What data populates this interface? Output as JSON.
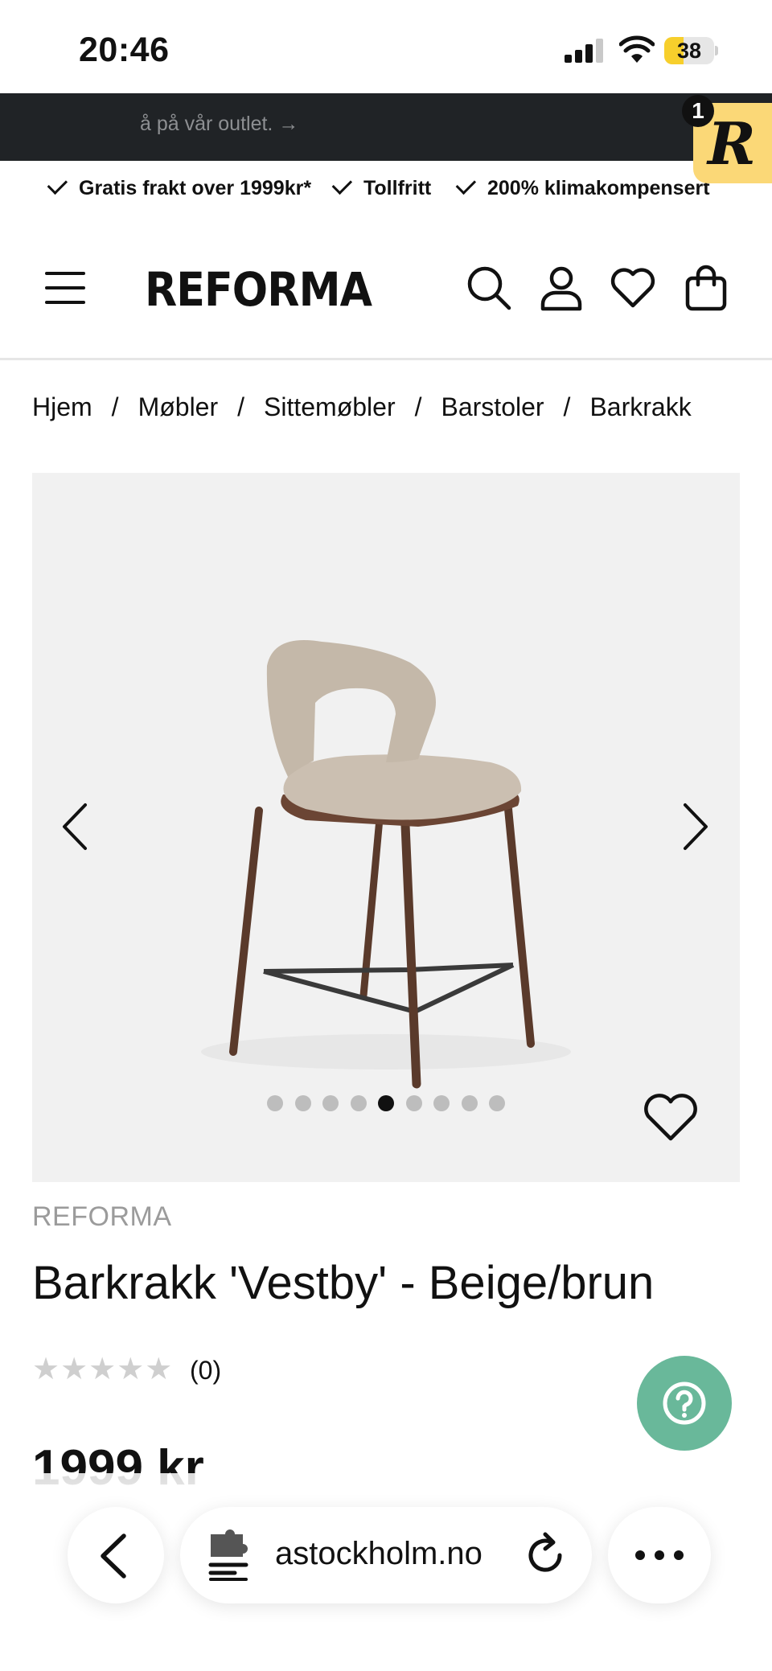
{
  "status_bar": {
    "time": "20:46",
    "battery_level": "38",
    "battery_fraction": 0.38,
    "battery_color": "#f7cf2c"
  },
  "announcement": {
    "text": "å på vår outlet. →",
    "background": "#202326"
  },
  "reviews_widget": {
    "letter": "R",
    "count": "1",
    "color": "#fbd877"
  },
  "usp": {
    "items": [
      {
        "label": "Gratis frakt over 1999kr*"
      },
      {
        "label": "Tollfritt"
      },
      {
        "label": "200% klimakompensert"
      }
    ]
  },
  "header": {
    "logo": "REFORMA",
    "icons": [
      "menu-icon",
      "search-icon",
      "account-icon",
      "wishlist-icon",
      "cart-icon"
    ]
  },
  "breadcrumb": {
    "items": [
      "Hjem",
      "Møbler",
      "Sittemøbler",
      "Barstoler",
      "Barkrakk"
    ],
    "separator": "/"
  },
  "gallery": {
    "slide_count": 9,
    "active_index": 4,
    "image": "beige-bar-stool-with-brown-metal-legs"
  },
  "product": {
    "brand": "REFORMA",
    "title": "Barkrakk 'Vestby' - Beige/brun",
    "rating_stars": "★★★★★",
    "rating_value": 0,
    "rating_count": "(0)",
    "price": "1999 kr"
  },
  "help_button": {
    "icon": "help-icon",
    "color": "#69b89a"
  },
  "browser": {
    "url": "astockholm.no",
    "icons": [
      "back-icon",
      "extension-icon",
      "reload-icon",
      "more-icon"
    ]
  }
}
